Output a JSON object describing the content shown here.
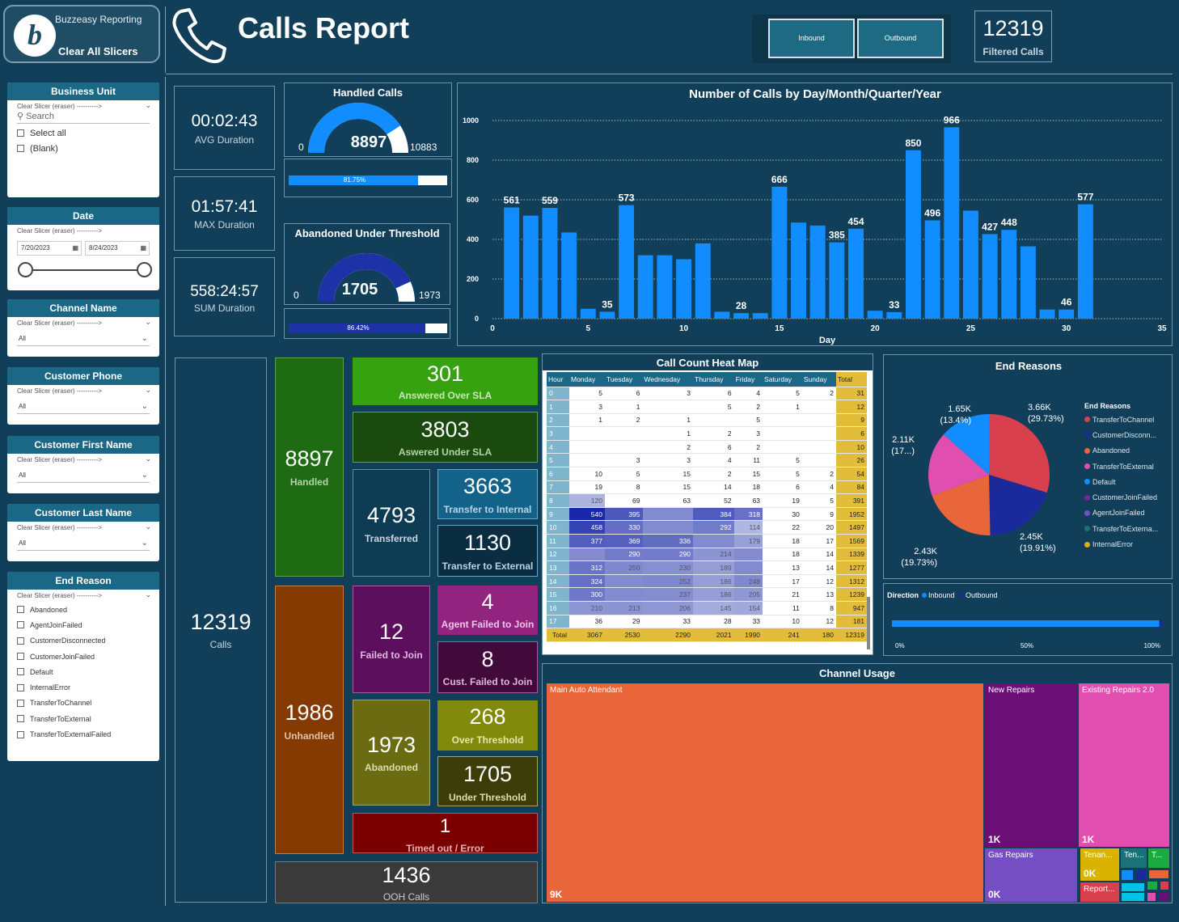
{
  "header": {
    "brand": "Buzzeasy Reporting",
    "clear_all": "Clear All Slicers",
    "title": "Calls Report",
    "inbound_label": "Inbound",
    "outbound_label": "Outbound",
    "filtered_value": "12319",
    "filtered_label": "Filtered Calls"
  },
  "slicers": {
    "clear_text": "Clear Slicer (eraser) ---------->",
    "business_unit": {
      "title": "Business Unit",
      "search_placeholder": "Search",
      "options": [
        "Select all",
        "(Blank)"
      ]
    },
    "date": {
      "title": "Date",
      "start": "7/20/2023",
      "end": "8/24/2023"
    },
    "channel_name": {
      "title": "Channel Name",
      "value": "All"
    },
    "customer_phone": {
      "title": "Customer Phone",
      "value": "All"
    },
    "customer_first_name": {
      "title": "Customer First Name",
      "value": "All"
    },
    "customer_last_name": {
      "title": "Customer Last Name",
      "value": "All"
    },
    "end_reason": {
      "title": "End Reason",
      "options": [
        "Abandoned",
        "AgentJoinFailed",
        "CustomerDisconnected",
        "CustomerJoinFailed",
        "Default",
        "InternalError",
        "TransferToChannel",
        "TransferToExternal",
        "TransferToExternalFailed"
      ]
    }
  },
  "kpis": {
    "avg_duration": {
      "value": "00:02:43",
      "label": "AVG Duration"
    },
    "max_duration": {
      "value": "01:57:41",
      "label": "MAX Duration"
    },
    "sum_duration": {
      "value": "558:24:57",
      "label": "SUM Duration"
    }
  },
  "gauges": {
    "handled": {
      "title": "Handled Calls",
      "value": "8897",
      "min": "0",
      "max": "10883",
      "percent_label": "81.75%",
      "percent": 0.8175,
      "color": "#118dff"
    },
    "abandoned": {
      "title": "Abandoned Under Threshold",
      "value": "1705",
      "min": "0",
      "max": "1973",
      "percent_label": "86.42%",
      "percent": 0.8642,
      "color": "#1e32a8"
    }
  },
  "tiles": {
    "total_calls": {
      "value": "12319",
      "label": "Calls"
    },
    "handled": {
      "value": "8897",
      "label": "Handled"
    },
    "answered_over_sla": {
      "value": "301",
      "label": "Answered Over SLA"
    },
    "answered_under_sla": {
      "value": "3803",
      "label": "Aswered Under SLA"
    },
    "transferred": {
      "value": "4793",
      "label": "Transferred"
    },
    "transfer_internal": {
      "value": "3663",
      "label": "Transfer to Internal"
    },
    "transfer_external": {
      "value": "1130",
      "label": "Transfer to External"
    },
    "unhandled": {
      "value": "1986",
      "label": "Unhandled"
    },
    "failed_to_join": {
      "value": "12",
      "label": "Failed to Join"
    },
    "agent_failed": {
      "value": "4",
      "label": "Agent Failed to Join"
    },
    "cust_failed": {
      "value": "8",
      "label": "Cust. Failed to Join"
    },
    "abandoned": {
      "value": "1973",
      "label": "Abandoned"
    },
    "over_threshold": {
      "value": "268",
      "label": "Over Threshold"
    },
    "under_threshold": {
      "value": "1705",
      "label": "Under Threshold"
    },
    "timed_out": {
      "value": "1",
      "label": "Timed out / Error"
    },
    "ooh": {
      "value": "1436",
      "label": "OOH Calls"
    }
  },
  "chart_data": [
    {
      "type": "bar",
      "title": "Number of Calls by Day/Month/Quarter/Year",
      "xlabel": "Day",
      "ylabel": "",
      "xlim": [
        0,
        35
      ],
      "ylim": [
        0,
        1000
      ],
      "xticks": [
        0,
        5,
        10,
        15,
        20,
        25,
        30,
        35
      ],
      "yticks": [
        0,
        200,
        400,
        600,
        800,
        1000
      ],
      "grid": true,
      "x": [
        1,
        2,
        3,
        4,
        5,
        6,
        7,
        8,
        9,
        10,
        11,
        12,
        13,
        14,
        15,
        16,
        17,
        18,
        19,
        20,
        21,
        22,
        23,
        24,
        25,
        26,
        27,
        28,
        29,
        30,
        31
      ],
      "values": [
        561,
        520,
        559,
        435,
        50,
        35,
        573,
        320,
        320,
        300,
        380,
        35,
        28,
        28,
        666,
        485,
        470,
        385,
        454,
        40,
        33,
        850,
        496,
        966,
        545,
        427,
        448,
        365,
        46,
        46,
        577
      ],
      "data_labels": {
        "1": "561",
        "3": "559",
        "6": "35",
        "7": "573",
        "13": "28",
        "15": "666",
        "18": "385",
        "19": "454",
        "21": "33",
        "22": "850",
        "23": "496",
        "24": "966",
        "26": "427",
        "27": "448",
        "30": "46",
        "31": "577"
      },
      "color": "#118dff"
    },
    {
      "type": "pie",
      "title": "End Reasons",
      "legend_title": "End Reasons",
      "legend_position": "right",
      "slices": [
        {
          "name": "TransferToChannel",
          "value": 3660,
          "label": "3.66K (29.73%)",
          "color": "#d9404d"
        },
        {
          "name": "CustomerDisconn...",
          "value": 2450,
          "label": "2.45K (19.91%)",
          "color": "#1a2a9a"
        },
        {
          "name": "Abandoned",
          "value": 2430,
          "label": "2.43K (19.73%)",
          "color": "#e8663a"
        },
        {
          "name": "TransferToExternal",
          "value": 2110,
          "label": "2.11K (17...)",
          "color": "#e04fb0"
        },
        {
          "name": "Default",
          "value": 1650,
          "label": "1.65K (13.4%)",
          "color": "#118dff"
        },
        {
          "name": "CustomerJoinFailed",
          "value": 0,
          "label": "",
          "color": "#6c2a9c"
        },
        {
          "name": "AgentJoinFailed",
          "value": 0,
          "label": "",
          "color": "#744ec2"
        },
        {
          "name": "TransferToExterna...",
          "value": 0,
          "label": "",
          "color": "#197278"
        },
        {
          "name": "InternalError",
          "value": 0,
          "label": "",
          "color": "#d9b300"
        }
      ]
    },
    {
      "type": "bar",
      "title": "Direction",
      "series": [
        {
          "name": "Inbound",
          "value": 99,
          "color": "#118dff"
        },
        {
          "name": "Outbound",
          "value": 1,
          "color": "#1a2a9a"
        }
      ],
      "xticks": [
        "0%",
        "50%",
        "100%"
      ]
    },
    {
      "type": "heatmap",
      "title": "Call Count Heat Map",
      "columns": [
        "Hour",
        "Monday",
        "Tuesday",
        "Wednesday",
        "Thursday",
        "Friday",
        "Saturday",
        "Sunday",
        "Total"
      ],
      "rows": [
        [
          "0",
          "5",
          "6",
          "3",
          "6",
          "4",
          "5",
          "2",
          "31"
        ],
        [
          "1",
          "3",
          "1",
          "",
          "5",
          "2",
          "1",
          "",
          "12"
        ],
        [
          "2",
          "1",
          "2",
          "1",
          "",
          "5",
          "",
          "",
          "9"
        ],
        [
          "3",
          "",
          "",
          "1",
          "2",
          "3",
          "",
          "",
          "6"
        ],
        [
          "4",
          "",
          "",
          "2",
          "6",
          "2",
          "",
          "",
          "10"
        ],
        [
          "5",
          "",
          "3",
          "3",
          "4",
          "11",
          "5",
          "",
          "26"
        ],
        [
          "6",
          "10",
          "5",
          "15",
          "2",
          "15",
          "5",
          "2",
          "54"
        ],
        [
          "7",
          "19",
          "8",
          "15",
          "14",
          "18",
          "6",
          "4",
          "84"
        ],
        [
          "8",
          "120",
          "69",
          "63",
          "52",
          "63",
          "19",
          "5",
          "391"
        ],
        [
          "9",
          "540",
          "395",
          "",
          "384",
          "318",
          "30",
          "9",
          "1952"
        ],
        [
          "10",
          "458",
          "330",
          "",
          "292",
          "114",
          "22",
          "20",
          "1497"
        ],
        [
          "11",
          "377",
          "369",
          "336",
          "",
          "179",
          "18",
          "17",
          "1569"
        ],
        [
          "12",
          "",
          "290",
          "290",
          "214",
          "",
          "18",
          "14",
          "1339"
        ],
        [
          "13",
          "312",
          "250",
          "230",
          "189",
          "",
          "13",
          "14",
          "1277"
        ],
        [
          "14",
          "324",
          "",
          "252",
          "186",
          "248",
          "17",
          "12",
          "1312"
        ],
        [
          "15",
          "300",
          "",
          "237",
          "186",
          "205",
          "21",
          "13",
          "1239"
        ],
        [
          "16",
          "210",
          "213",
          "206",
          "145",
          "154",
          "11",
          "8",
          "947"
        ],
        [
          "17",
          "36",
          "29",
          "33",
          "28",
          "33",
          "10",
          "12",
          "181"
        ]
      ],
      "total_row": [
        "Total",
        "3067",
        "2530",
        "2290",
        "2021",
        "1990",
        "241",
        "180",
        "12319"
      ]
    },
    {
      "type": "treemap",
      "title": "Channel Usage",
      "items": [
        {
          "name": "Main Auto Attendant",
          "label": "9K",
          "color": "#e8663a"
        },
        {
          "name": "New Repairs",
          "label": "1K",
          "color": "#6b0f77"
        },
        {
          "name": "Existing Repairs 2.0",
          "label": "1K",
          "color": "#e04fb0"
        },
        {
          "name": "Gas Repairs",
          "label": "0K",
          "color": "#744ec2"
        },
        {
          "name": "Tenan...",
          "label": "0K",
          "color": "#d9b300"
        },
        {
          "name": "Ten...",
          "label": "",
          "color": "#197278"
        },
        {
          "name": "T...",
          "label": "",
          "color": "#1aab40"
        },
        {
          "name": "Report...",
          "label": "",
          "color": "#d9404d"
        }
      ]
    }
  ]
}
